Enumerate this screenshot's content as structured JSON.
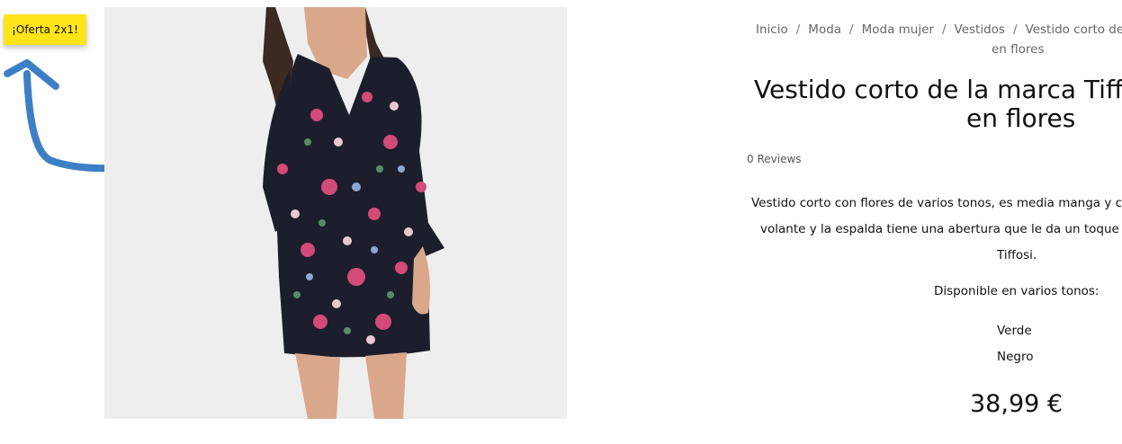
{
  "badge": {
    "label": "¡Oferta 2x1!"
  },
  "product_image": {
    "alt": "Vestido corto negro con flores"
  },
  "breadcrumb": {
    "items": [
      "Inicio",
      "Moda",
      "Moda mujer",
      "Vestidos",
      "Vestido corto de la"
    ],
    "separator": "/",
    "continuation": "en flores"
  },
  "product": {
    "title_line1": "Vestido corto de la marca Tiffosi",
    "title_line2": "en flores",
    "reviews": "0 Reviews",
    "description_line1": "Vestido corto con flores de varios tonos, es media manga y con",
    "description_line2": "volante y la espalda tiene una abertura que le da un toque de",
    "description_line3": "Tiffosi.",
    "availability": "Disponible en varios tonos:",
    "tones": [
      "Verde",
      "Negro"
    ],
    "price": "38,99 €"
  },
  "colors": {
    "badge": "#ffe419",
    "arrow": "#3d7fc4",
    "photo_background": "#eeeeef"
  }
}
